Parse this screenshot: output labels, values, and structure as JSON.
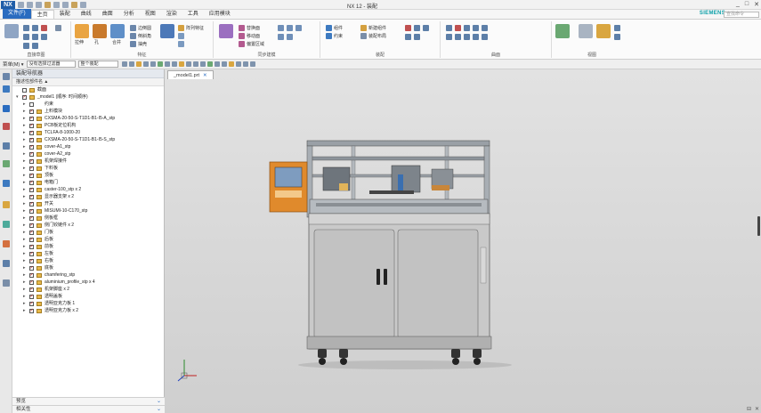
{
  "app": {
    "logo": "NX",
    "title": "NX 12 - 装配",
    "brand": "SIEMENS",
    "window_controls": [
      "_",
      "□",
      "✕"
    ]
  },
  "menu": {
    "file_tab": "文件(F)",
    "tabs": [
      "主页",
      "装配",
      "曲线",
      "曲面",
      "分析",
      "视图",
      "渲染",
      "工具",
      "应用模块"
    ],
    "active_tab": 0,
    "search_placeholder": "查找命令"
  },
  "ribbon": {
    "groups": [
      {
        "name": "直接草图"
      },
      {
        "name": "特征"
      },
      {
        "name": "同步建模"
      },
      {
        "name": "装配"
      },
      {
        "name": "曲面"
      },
      {
        "name": "视图"
      }
    ],
    "labels": [
      "拉伸",
      "孔",
      "合并",
      "边倒圆",
      "倒斜角",
      "抽壳",
      "阵列特征",
      "替换面",
      "移动面",
      "偏置区域",
      "组件",
      "约束",
      "新建组件",
      "装配布局"
    ]
  },
  "toolbar": {
    "menu_label": "菜单(M) ▾",
    "filter_value": "没有选择过滤器",
    "scope_value": "整个装配"
  },
  "navigator": {
    "header": "装配导航器",
    "column_header": "描述性部件名 ▲",
    "rows": [
      {
        "indent": 0,
        "label": "截面",
        "checked": false,
        "expand": "",
        "icon": true
      },
      {
        "indent": 0,
        "label": "_model1 (顺序: 时间顺序)",
        "checked": true,
        "expand": "▾",
        "icon": true
      },
      {
        "indent": 1,
        "label": "约束",
        "checked": false,
        "expand": "▸",
        "icon": false
      },
      {
        "indent": 1,
        "label": "上料模块",
        "checked": true,
        "expand": "▸",
        "icon": true
      },
      {
        "indent": 1,
        "label": "CXSMA-20-50-S-T1D1-B1-I5-A_stp",
        "checked": true,
        "expand": "▸",
        "icon": true
      },
      {
        "indent": 1,
        "label": "PCB板定位机构",
        "checked": true,
        "expand": "▸",
        "icon": true
      },
      {
        "indent": 1,
        "label": "TCLFA-8-1000-20",
        "checked": true,
        "expand": "▸",
        "icon": true
      },
      {
        "indent": 1,
        "label": "CXSMA-20-50-S-T1D1-B1-I5-S_stp",
        "checked": true,
        "expand": "▸",
        "icon": true
      },
      {
        "indent": 1,
        "label": "cover-A1_stp",
        "checked": true,
        "expand": "▸",
        "icon": true
      },
      {
        "indent": 1,
        "label": "cover-A2_stp",
        "checked": true,
        "expand": "▸",
        "icon": true
      },
      {
        "indent": 1,
        "label": "机架焊接件",
        "checked": true,
        "expand": "▸",
        "icon": true
      },
      {
        "indent": 1,
        "label": "下料板",
        "checked": true,
        "expand": "▸",
        "icon": true
      },
      {
        "indent": 1,
        "label": "顶板",
        "checked": true,
        "expand": "▸",
        "icon": true
      },
      {
        "indent": 1,
        "label": "电箱门",
        "checked": true,
        "expand": "▸",
        "icon": true
      },
      {
        "indent": 1,
        "label": "caster-100_stp x 2",
        "checked": true,
        "expand": "▸",
        "icon": true
      },
      {
        "indent": 1,
        "label": "显示器支架 x 2",
        "checked": true,
        "expand": "▸",
        "icon": true
      },
      {
        "indent": 1,
        "label": "开关",
        "checked": true,
        "expand": "▸",
        "icon": true
      },
      {
        "indent": 1,
        "label": "MISUMI-10-C170_stp",
        "checked": true,
        "expand": "▸",
        "icon": true
      },
      {
        "indent": 1,
        "label": "侧板框",
        "checked": true,
        "expand": "▸",
        "icon": true
      },
      {
        "indent": 1,
        "label": "侧门铰链件 x 2",
        "checked": true,
        "expand": "▸",
        "icon": true
      },
      {
        "indent": 1,
        "label": "门板",
        "checked": true,
        "expand": "▸",
        "icon": true
      },
      {
        "indent": 1,
        "label": "后板",
        "checked": true,
        "expand": "▸",
        "icon": true
      },
      {
        "indent": 1,
        "label": "前板",
        "checked": true,
        "expand": "▸",
        "icon": true
      },
      {
        "indent": 1,
        "label": "左板",
        "checked": true,
        "expand": "▸",
        "icon": true
      },
      {
        "indent": 1,
        "label": "右板",
        "checked": true,
        "expand": "▸",
        "icon": true
      },
      {
        "indent": 1,
        "label": "底板",
        "checked": true,
        "expand": "▸",
        "icon": true
      },
      {
        "indent": 1,
        "label": "chamfering_stp",
        "checked": true,
        "expand": "▸",
        "icon": true
      },
      {
        "indent": 1,
        "label": "aluminium_profile_stp x 4",
        "checked": true,
        "expand": "▸",
        "icon": true
      },
      {
        "indent": 1,
        "label": "机架脚座 x 2",
        "checked": true,
        "expand": "▸",
        "icon": true
      },
      {
        "indent": 1,
        "label": "透明盖板",
        "checked": true,
        "expand": "▸",
        "icon": true
      },
      {
        "indent": 1,
        "label": "透明亚克力板 1",
        "checked": true,
        "expand": "▸",
        "icon": true
      },
      {
        "indent": 1,
        "label": "透明亚克力板 x 2",
        "checked": true,
        "expand": "▸",
        "icon": true
      }
    ],
    "accordion": [
      "预览",
      "相关性"
    ]
  },
  "graphics": {
    "tab_label": "_model1.prt",
    "tab_close": "✕",
    "bottom_buttons": [
      "⊟",
      "✕"
    ]
  },
  "colors": {
    "accent": "#2a6cc0",
    "brand": "#0a9fa8",
    "machine_body": "#c8c8c8",
    "panel_orange": "#e08a2c"
  }
}
